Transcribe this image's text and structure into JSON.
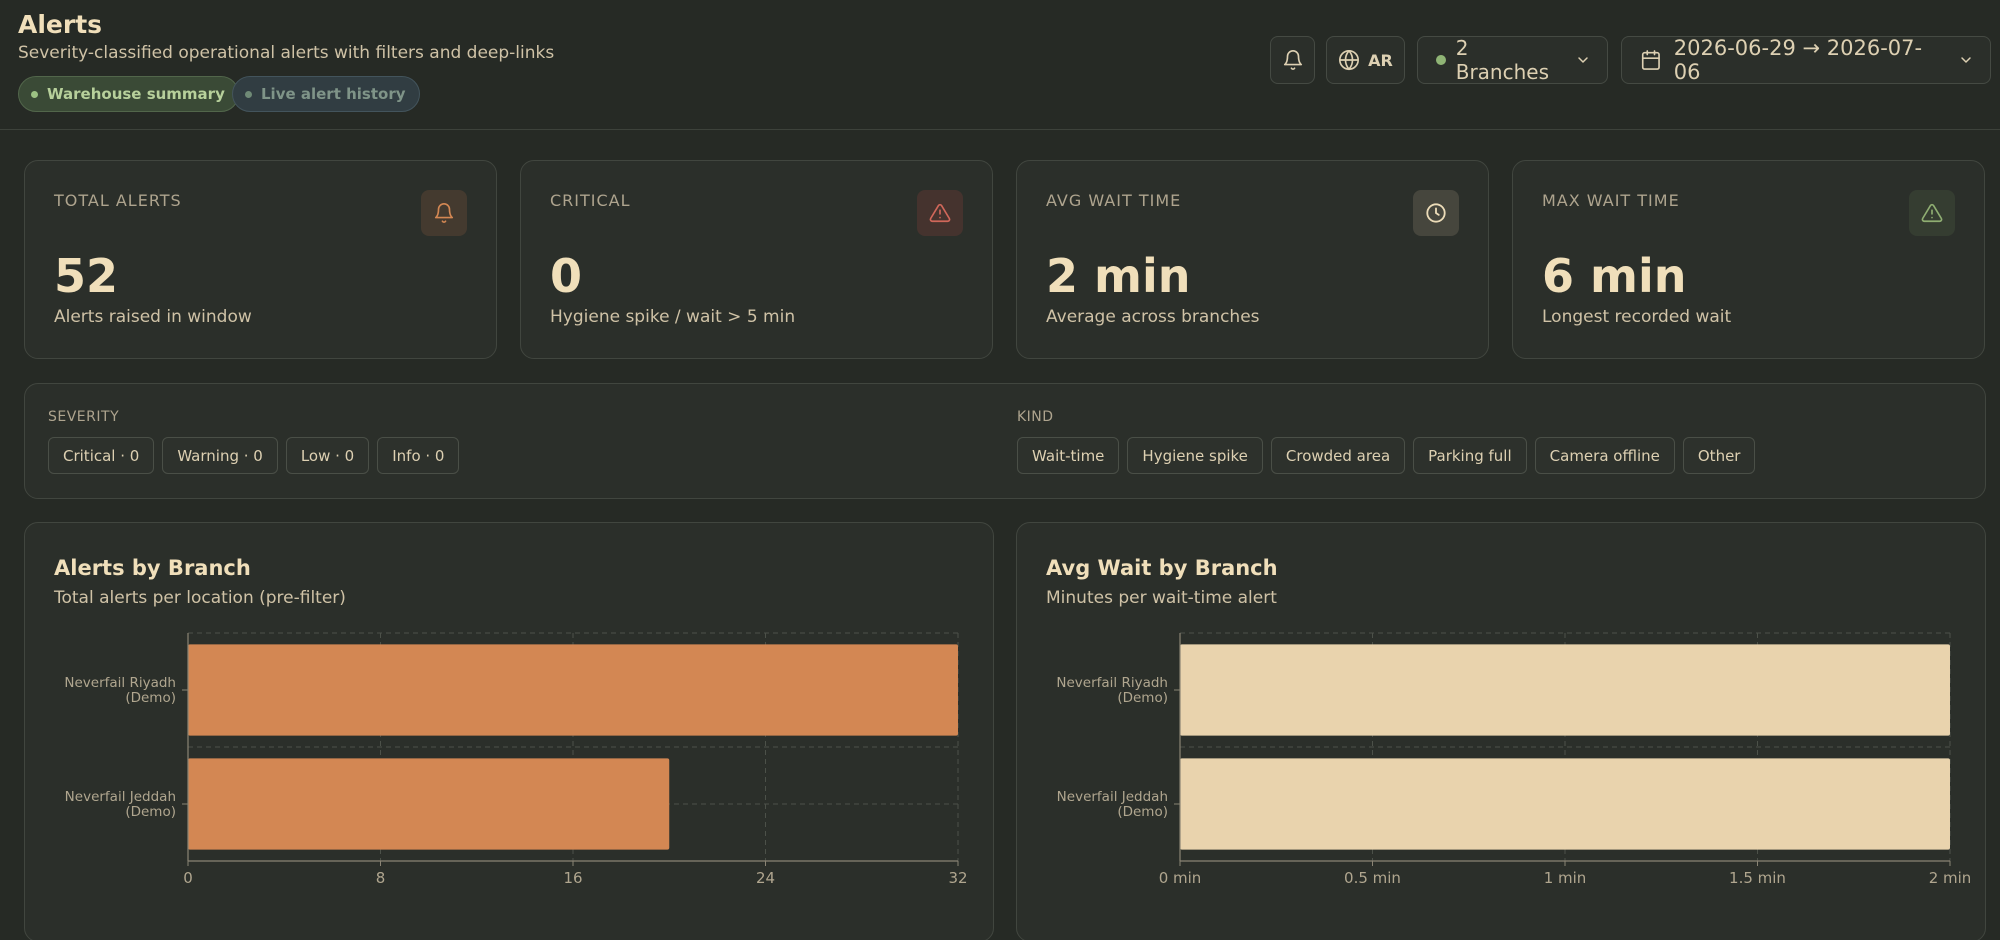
{
  "header": {
    "title": "Alerts",
    "subtitle": "Severity-classified operational alerts with filters and deep-links",
    "pills": {
      "warehouse": "Warehouse summary",
      "live": "Live alert history"
    },
    "language": "AR",
    "branches": "2 Branches",
    "date_range": "2026-06-29 → 2026-07-06"
  },
  "kpis": [
    {
      "label": "TOTAL ALERTS",
      "value": "52",
      "sub": "Alerts raised in window",
      "icon": "bell-icon"
    },
    {
      "label": "CRITICAL",
      "value": "0",
      "sub": "Hygiene spike / wait > 5 min",
      "icon": "warning-icon"
    },
    {
      "label": "AVG WAIT TIME",
      "value": "2 min",
      "sub": "Average across branches",
      "icon": "clock-icon"
    },
    {
      "label": "MAX WAIT TIME",
      "value": "6 min",
      "sub": "Longest recorded wait",
      "icon": "warning-icon"
    }
  ],
  "filters": {
    "severity_title": "SEVERITY",
    "severity": [
      "Critical · 0",
      "Warning · 0",
      "Low · 0",
      "Info · 0"
    ],
    "kind_title": "KIND",
    "kind": [
      "Wait-time",
      "Hygiene spike",
      "Crowded area",
      "Parking full",
      "Camera offline",
      "Other"
    ]
  },
  "colors": {
    "orange": "#d38753",
    "cream": "#e9d3ad",
    "bg": "#262a25",
    "card": "#2b2f2a"
  },
  "chart_data": [
    {
      "type": "bar",
      "orientation": "horizontal",
      "title": "Alerts by Branch",
      "subtitle": "Total alerts per location (pre-filter)",
      "categories": [
        [
          "Neverfail Riyadh",
          "(Demo)"
        ],
        [
          "Neverfail Jeddah",
          "(Demo)"
        ]
      ],
      "values": [
        32,
        20
      ],
      "xlim": [
        0,
        32
      ],
      "ticks": [
        "0",
        "8",
        "16",
        "24",
        "32"
      ],
      "tick_values": [
        0,
        8,
        16,
        24,
        32
      ],
      "grid": true,
      "color": "#d38753"
    },
    {
      "type": "bar",
      "orientation": "horizontal",
      "title": "Avg Wait by Branch",
      "subtitle": "Minutes per wait-time alert",
      "categories": [
        [
          "Neverfail Riyadh",
          "(Demo)"
        ],
        [
          "Neverfail Jeddah",
          "(Demo)"
        ]
      ],
      "values": [
        2,
        2
      ],
      "xlim": [
        0,
        2
      ],
      "ticks": [
        "0 min",
        "0.5 min",
        "1 min",
        "1.5 min",
        "2 min"
      ],
      "tick_values": [
        0,
        0.5,
        1,
        1.5,
        2
      ],
      "grid": true,
      "color": "#e9d3ad"
    }
  ]
}
